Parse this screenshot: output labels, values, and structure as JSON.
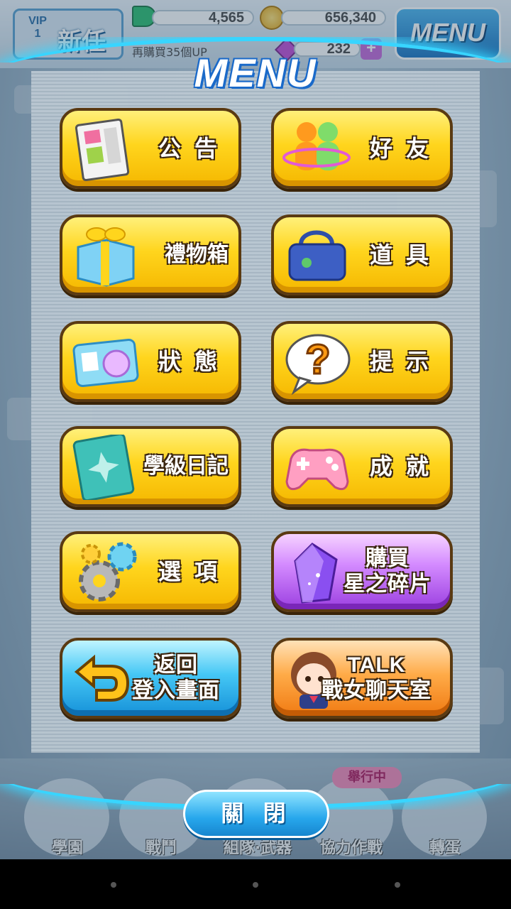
{
  "hud": {
    "vip_label": "VIP\n1",
    "rank": "新任",
    "stat1_value": "4,565",
    "stat2_value": "656,340",
    "gem_value": "232",
    "sub_text": "再購買35個UP",
    "menu_button": "MENU",
    "plus": "+"
  },
  "menu": {
    "title": "MENU",
    "items": [
      {
        "label": "公 告",
        "icon": "newspaper-icon"
      },
      {
        "label": "好 友",
        "icon": "friends-icon"
      },
      {
        "label": "禮物箱",
        "icon": "gift-box-icon"
      },
      {
        "label": "道 具",
        "icon": "school-bag-icon"
      },
      {
        "label": "狀 態",
        "icon": "id-card-icon"
      },
      {
        "label": "提 示",
        "icon": "question-bubble-icon"
      },
      {
        "label": "學級日記",
        "icon": "diary-book-icon"
      },
      {
        "label": "成 就",
        "icon": "gamepad-icon"
      },
      {
        "label": "選 項",
        "icon": "gears-icon"
      },
      {
        "label_line1": "購買",
        "label_line2": "星之碎片",
        "icon": "star-crystal-icon"
      },
      {
        "label_line1": "返回",
        "label_line2": "登入畫面",
        "icon": "return-arrow-icon"
      },
      {
        "label_line1": "TALK",
        "label_line2": "戰女聊天室",
        "icon": "chat-girl-icon"
      }
    ]
  },
  "bottom_nav": {
    "items": [
      "學園",
      "戰鬥",
      "組隊·武器",
      "協力作戰",
      "轉蛋"
    ],
    "event_badge": "舉行中"
  },
  "close_button": "關 閉",
  "colors": {
    "yellow_button": "#ffd51d",
    "accent_cyan": "#38d5ff",
    "button_outline": "#5a3a12"
  }
}
